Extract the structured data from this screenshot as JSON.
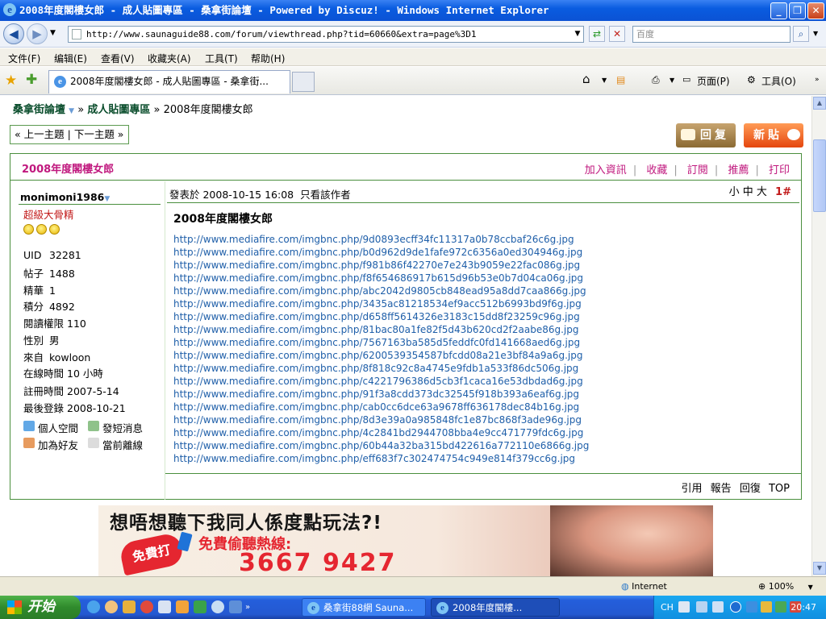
{
  "window": {
    "title": "2008年度閣樓女郎 - 成人貼圖專區 - 桑拿街論壇 - Powered by Discuz! - Windows Internet Explorer"
  },
  "address_bar": {
    "url": "http://www.saunaguide88.com/forum/viewthread.php?tid=60660&extra=page%3D1",
    "search_placeholder": "百度"
  },
  "menu": [
    "文件(F)",
    "编辑(E)",
    "查看(V)",
    "收藏夹(A)",
    "工具(T)",
    "帮助(H)"
  ],
  "tab": {
    "title": "2008年度閣樓女郎 - 成人貼圖專區 - 桑拿街...",
    "tools": {
      "page": "页面(P)",
      "tools": "工具(O)"
    }
  },
  "breadcrumb": {
    "forum": "桑拿街論壇",
    "sep1": "»",
    "board": "成人貼圖專區",
    "sep2": "»",
    "thread": "2008年度閣樓女郎"
  },
  "thread_nav": {
    "prev": "« 上一主題",
    "sep": "|",
    "next": "下一主題 »"
  },
  "buttons": {
    "reply": "回复",
    "new_post": "新貼"
  },
  "thread": {
    "title": "2008年度閣樓女郎",
    "actions": [
      "加入資訊",
      "收藏",
      "訂閱",
      "推薦",
      "打印"
    ]
  },
  "author": {
    "name": "monimoni1986",
    "rank": "超級大骨精",
    "stats": [
      {
        "label": "UID",
        "value": "32281"
      },
      {
        "label": "帖子",
        "value": "1488"
      },
      {
        "label": "精華",
        "value": "1"
      },
      {
        "label": "積分",
        "value": "4892"
      },
      {
        "label": "閱讀權限",
        "value": "110"
      },
      {
        "label": "性別",
        "value": "男"
      },
      {
        "label": "來自",
        "value": "kowloon"
      },
      {
        "label": "在線時間",
        "value": "10 小時"
      },
      {
        "label": "註冊時間",
        "value": "2007-5-14"
      },
      {
        "label": "最後登錄",
        "value": "2008-10-21"
      }
    ],
    "links": {
      "space": "個人空間",
      "pm": "發短消息",
      "friend": "加為好友",
      "status": "當前離線"
    }
  },
  "post": {
    "posted_at": "發表於 2008-10-15 16:08",
    "only_author": "只看該作者",
    "font_sizes": {
      "small": "小",
      "medium": "中",
      "large": "大"
    },
    "floor": "1#",
    "title": "2008年度閣樓女郎",
    "links": [
      "http://www.mediafire.com/imgbnc.php/9d0893ecff34fc11317a0b78ccbaf26c6g.jpg",
      "http://www.mediafire.com/imgbnc.php/b0d962d9de1fafe972c6356a0ed304946g.jpg",
      "http://www.mediafire.com/imgbnc.php/f981b86f42270e7e243b9059e22fac086g.jpg",
      "http://www.mediafire.com/imgbnc.php/f8f654686917b615d96b53e0b7d04ca06g.jpg",
      "http://www.mediafire.com/imgbnc.php/abc2042d9805cb848ead95a8dd7caa866g.jpg",
      "http://www.mediafire.com/imgbnc.php/3435ac81218534ef9acc512b6993bd9f6g.jpg",
      "http://www.mediafire.com/imgbnc.php/d658ff5614326e3183c15dd8f23259c96g.jpg",
      "http://www.mediafire.com/imgbnc.php/81bac80a1fe82f5d43b620cd2f2aabe86g.jpg",
      "http://www.mediafire.com/imgbnc.php/7567163ba585d5feddfc0fd141668aed6g.jpg",
      "http://www.mediafire.com/imgbnc.php/6200539354587bfcdd08a21e3bf84a9a6g.jpg",
      "http://www.mediafire.com/imgbnc.php/8f818c92c8a4745e9fdb1a533f86dc506g.jpg",
      "http://www.mediafire.com/imgbnc.php/c4221796386d5cb3f1caca16e53dbdad6g.jpg",
      "http://www.mediafire.com/imgbnc.php/91f3a8cdd373dc32545f918b393a6eaf6g.jpg",
      "http://www.mediafire.com/imgbnc.php/cab0cc6dce63a9678ff636178dec84b16g.jpg",
      "http://www.mediafire.com/imgbnc.php/8d3e39a0a985848fc1e87bc868f3ade96g.jpg",
      "http://www.mediafire.com/imgbnc.php/4c2841bd2944708bba4e9cc471779fdc6g.jpg",
      "http://www.mediafire.com/imgbnc.php/60b44a32ba315bd422616a772110e6866g.jpg",
      "http://www.mediafire.com/imgbnc.php/eff683f7c302474754c949e814f379cc6g.jpg"
    ],
    "footer": {
      "quote": "引用",
      "report": "報告",
      "reply": "回復",
      "top": "TOP"
    }
  },
  "banner": {
    "headline": "想唔想聽下我同人係度點玩法?!",
    "badge": "免費打",
    "subline": "免費偷聽熱線:",
    "phone": "3667 9427"
  },
  "status_bar": {
    "zone": "Internet",
    "zoom": "100%"
  },
  "taskbar": {
    "start": "开始",
    "tasks": [
      "桑拿街88網 Sauna...",
      "2008年度閣樓..."
    ],
    "lang": "CH",
    "clock": "20:47"
  },
  "colors": {
    "accent_pink": "#c0187e",
    "forum_green": "#4a8f3e",
    "link_blue": "#1f5fa9",
    "xp_blue": "#245edb"
  }
}
